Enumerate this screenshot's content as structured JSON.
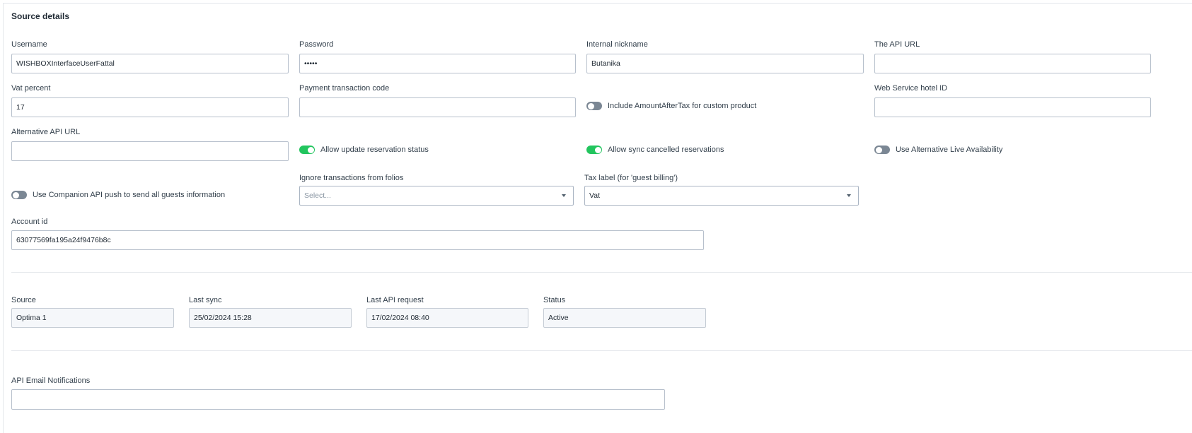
{
  "section": {
    "title": "Source details"
  },
  "fields": {
    "username": {
      "label": "Username",
      "value": "WISHBOXInterfaceUserFattal"
    },
    "password": {
      "label": "Password",
      "value": "•••••"
    },
    "nickname": {
      "label": "Internal nickname",
      "value": "Butanika"
    },
    "api_url": {
      "label": "The API URL",
      "value": ""
    },
    "vat": {
      "label": "Vat percent",
      "value": "17"
    },
    "payment_code": {
      "label": "Payment transaction code",
      "value": ""
    },
    "hotel_id": {
      "label": "Web Service hotel ID",
      "value": ""
    },
    "alt_api_url": {
      "label": "Alternative API URL",
      "value": ""
    },
    "ignore_folios": {
      "label": "Ignore transactions from folios",
      "placeholder": "Select..."
    },
    "tax_label": {
      "label": "Tax label (for 'guest billing')",
      "value": "Vat"
    },
    "account_id": {
      "label": "Account id",
      "value": "63077569fa195a24f9476b8c"
    },
    "email_notifications": {
      "label": "API Email Notifications",
      "value": ""
    }
  },
  "toggles": {
    "amount_after_tax": {
      "label": "Include AmountAfterTax for custom product",
      "on": false
    },
    "update_status": {
      "label": "Allow update reservation status",
      "on": true
    },
    "sync_cancelled": {
      "label": "Allow sync cancelled reservations",
      "on": true
    },
    "alt_live_avail": {
      "label": "Use Alternative Live Availability",
      "on": false
    },
    "companion_push": {
      "label": "Use Companion API push to send all guests information",
      "on": false
    }
  },
  "status": {
    "source": {
      "label": "Source",
      "value": "Optima 1"
    },
    "last_sync": {
      "label": "Last sync",
      "value": "25/02/2024 15:28"
    },
    "last_api": {
      "label": "Last API request",
      "value": "17/02/2024 08:40"
    },
    "state": {
      "label": "Status",
      "value": "Active"
    }
  },
  "colors": {
    "toggle_on": "#22c55e",
    "toggle_off": "#7b8794",
    "border": "#b7c0cc"
  }
}
